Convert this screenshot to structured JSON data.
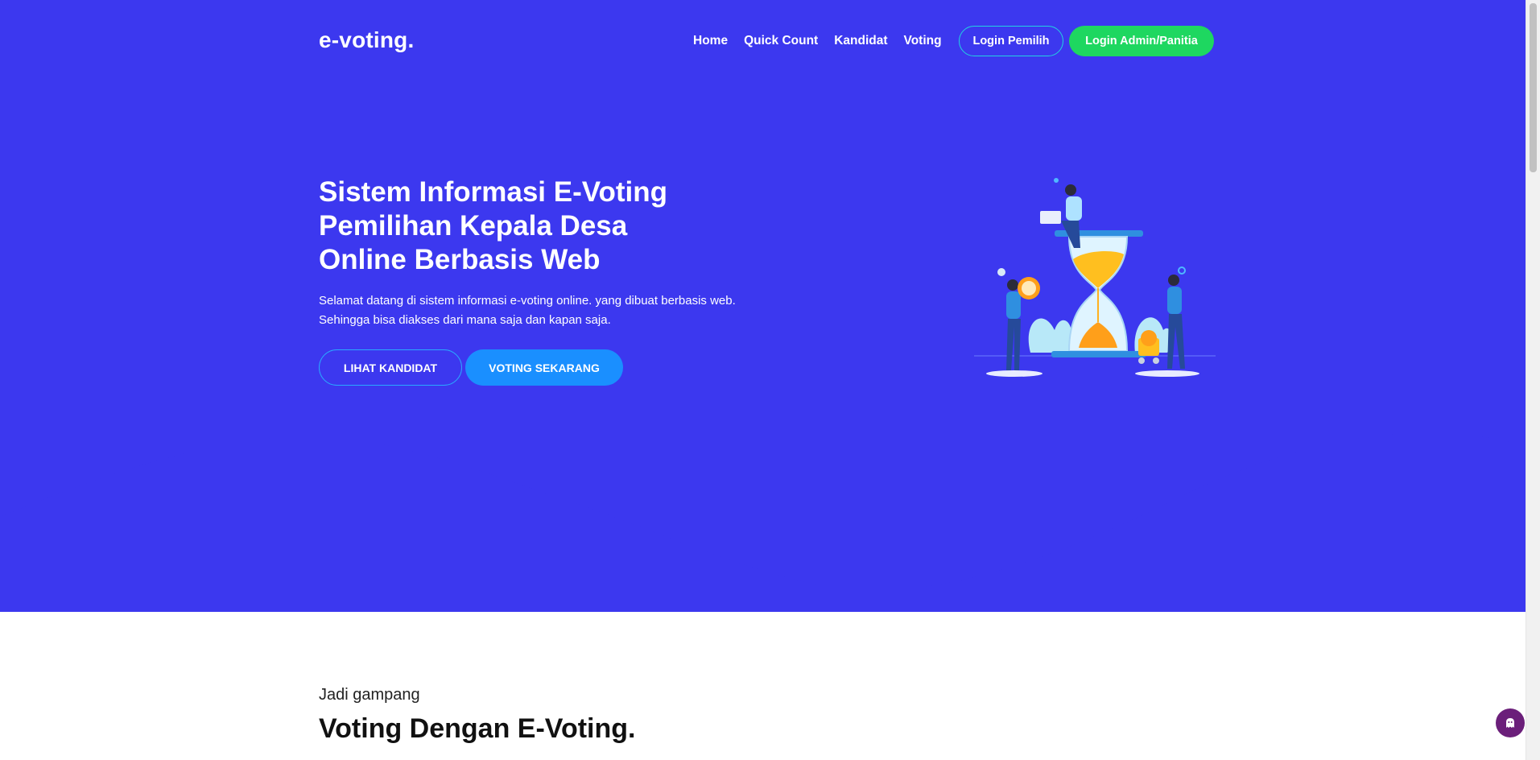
{
  "logo": "e-voting.",
  "nav": {
    "items": [
      "Home",
      "Quick Count",
      "Kandidat",
      "Voting"
    ],
    "login_pemilih": "Login Pemilih",
    "login_admin": "Login Admin/Panitia"
  },
  "hero": {
    "title_line1_a": "Sistem Informasi ",
    "title_line1_b": "E-Voting",
    "title_line2": "Pemilihan Kepala Desa",
    "title_line3": "Online Berbasis Web",
    "subtitle_line1": "Selamat datang di sistem informasi e-voting online. yang dibuat berbasis web.",
    "subtitle_line2": "Sehingga bisa diakses dari mana saja dan kapan saja.",
    "btn_lihat": "LIHAT KANDIDAT",
    "btn_voting": "VOTING SEKARANG"
  },
  "section": {
    "kicker": "Jadi gampang",
    "heading": "Voting Dengan E-Voting."
  },
  "colors": {
    "hero_bg": "#3c38ef",
    "admin_button": "#1ed760",
    "voting_button": "#1a8fff",
    "chat_button": "#6b1f7a"
  },
  "icons": {
    "chat": "chat-ghost-icon"
  }
}
